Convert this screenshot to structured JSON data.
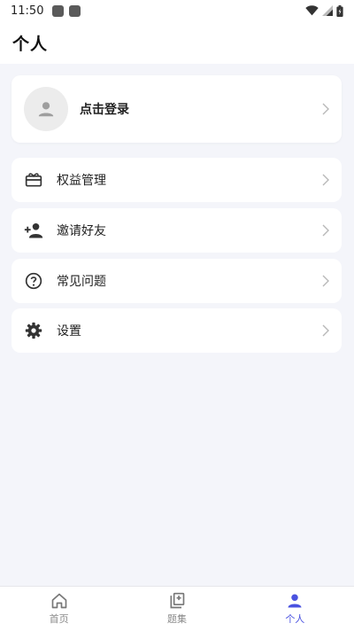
{
  "status_bar": {
    "time": "11:50"
  },
  "header": {
    "title": "个人"
  },
  "login": {
    "label": "点击登录"
  },
  "menu": [
    {
      "label": "权益管理",
      "icon": "gift-card-icon"
    },
    {
      "label": "邀请好友",
      "icon": "person-add-icon"
    },
    {
      "label": "常见问题",
      "icon": "help-circle-icon"
    },
    {
      "label": "设置",
      "icon": "gear-icon"
    }
  ],
  "bottom_nav": [
    {
      "label": "首页",
      "icon": "home-icon",
      "active": false
    },
    {
      "label": "题集",
      "icon": "question-set-icon",
      "active": false
    },
    {
      "label": "个人",
      "icon": "person-icon",
      "active": true
    }
  ],
  "colors": {
    "accent": "#4a52e0",
    "background": "#f4f5fa",
    "card": "#ffffff"
  }
}
